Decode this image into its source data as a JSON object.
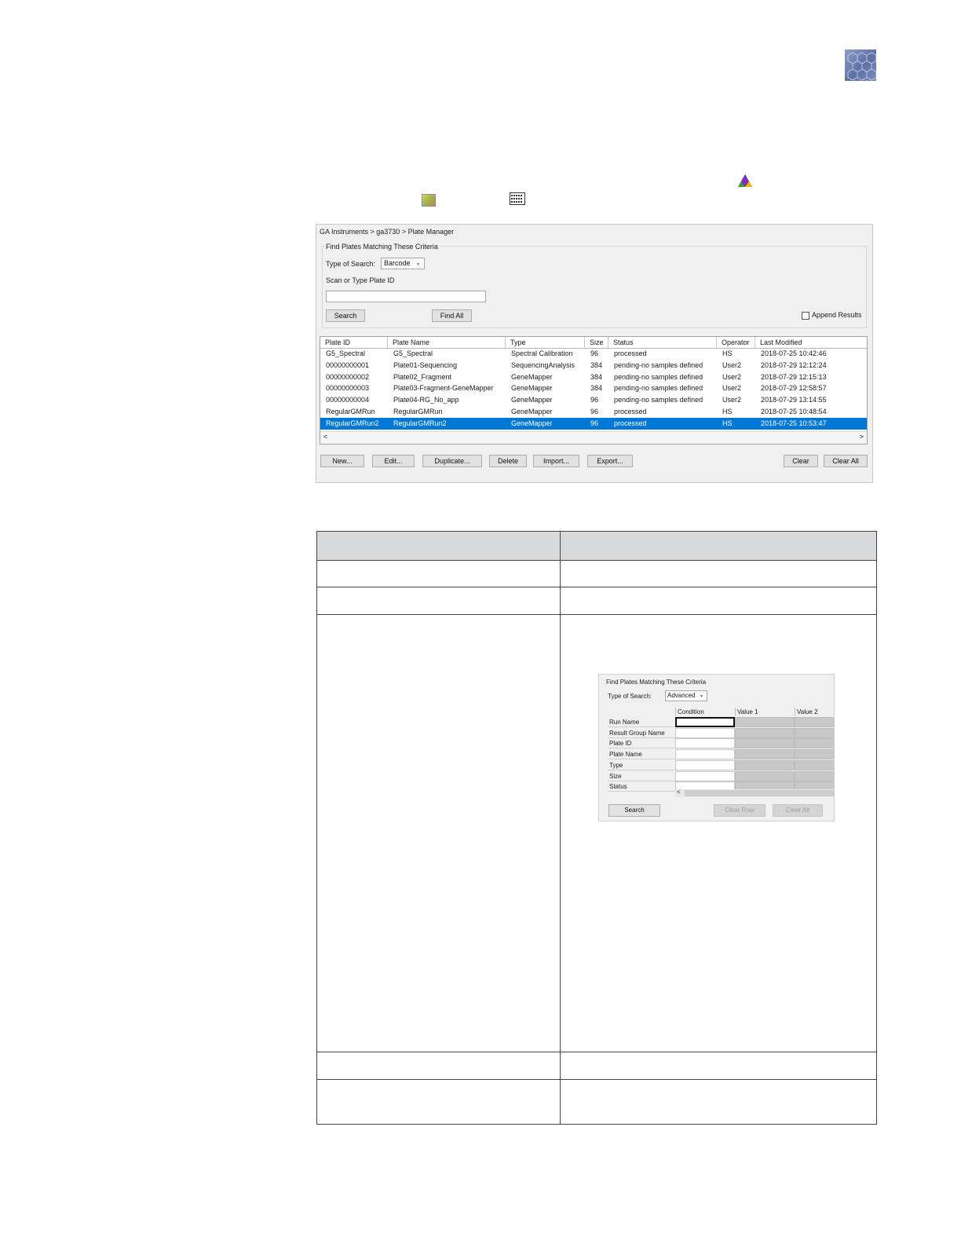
{
  "icons": {
    "corner_logo": "hexagon-pattern-logo-icon",
    "inline_1": "multicolor-triangle-icon",
    "inline_2": "colored-square-app-icon",
    "inline_3": "plate-grid-icon"
  },
  "plate_manager": {
    "breadcrumb": "GA Instruments > ga3730 > Plate Manager",
    "criteria_title": "Find Plates Matching These Criteria",
    "type_of_search_label": "Type of Search:",
    "type_of_search_value": "Barcode",
    "scan_label": "Scan or Type Plate ID",
    "plate_id_value": "",
    "search_button": "Search",
    "find_all_button": "Find All",
    "append_results_label": "Append Results",
    "append_results_checked": false,
    "columns": [
      "Plate ID",
      "Plate Name",
      "Type",
      "Size",
      "Status",
      "Operator",
      "Last Modified"
    ],
    "rows": [
      [
        "G5_Spectral",
        "G5_Spectral",
        "Spectral Calibration",
        "96",
        "processed",
        "HS",
        "2018-07-25 10:42:46"
      ],
      [
        "00000000001",
        "Plate01-Sequencing",
        "SequencingAnalysis",
        "384",
        "pending-no samples defined",
        "User2",
        "2018-07-29 12:12:24"
      ],
      [
        "00000000002",
        "Plate02_Fragment",
        "GeneMapper",
        "384",
        "pending-no samples defined",
        "User2",
        "2018-07-29 12:15:13"
      ],
      [
        "00000000003",
        "Plate03-Fragment-GeneMapper",
        "GeneMapper",
        "384",
        "pending-no samples defined",
        "User2",
        "2018-07-29 12:58:57"
      ],
      [
        "00000000004",
        "Plate04-RG_No_app",
        "GeneMapper",
        "96",
        "pending-no samples defined",
        "User2",
        "2018-07-29 13:14:55"
      ],
      [
        "RegularGMRun",
        "RegularGMRun",
        "GeneMapper",
        "96",
        "processed",
        "HS",
        "2018-07-25 10:48:54"
      ],
      [
        "RegularGMRun2",
        "RegularGMRun2",
        "GeneMapper",
        "96",
        "processed",
        "HS",
        "2018-07-25 10:53:47"
      ]
    ],
    "selected_row_index": 6,
    "scroll_left": "<",
    "scroll_right": ">",
    "buttons": {
      "new": "New...",
      "edit": "Edit...",
      "duplicate": "Duplicate...",
      "delete": "Delete",
      "import": "Import...",
      "export": "Export...",
      "clear": "Clear",
      "clear_all": "Clear All"
    },
    "selection_color": "#0078d7"
  },
  "advanced_search": {
    "criteria_title": "Find Plates Matching These Criteria",
    "type_of_search_label": "Type of Search:",
    "type_of_search_value": "Advanced",
    "columns": [
      "Condition",
      "Value 1",
      "Value 2"
    ],
    "rows": [
      "Run Name",
      "Result Group Name",
      "Plate ID",
      "Plate Name",
      "Type",
      "Size",
      "Status"
    ],
    "scroll_left": "<",
    "search_button": "Search",
    "clear_row_button": "Clear Row",
    "clear_all_button": "Clear All"
  }
}
